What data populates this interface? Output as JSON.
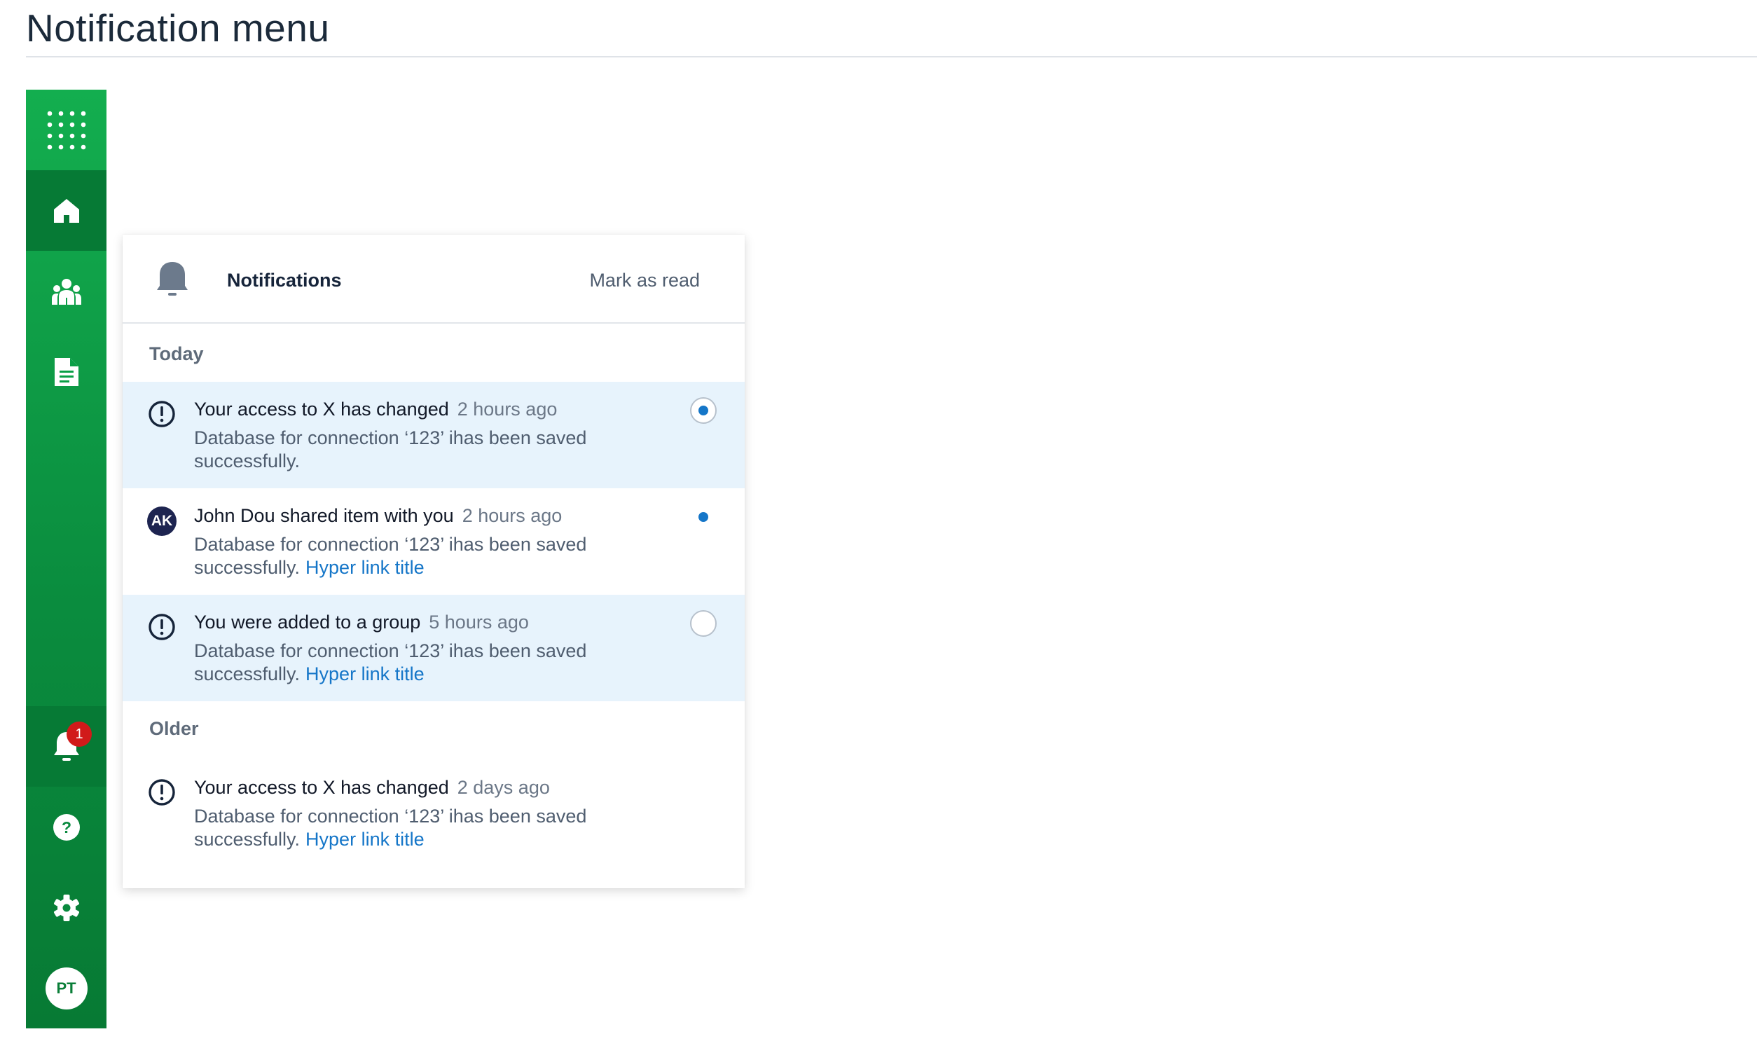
{
  "page": {
    "title": "Notification menu"
  },
  "sidebar": {
    "items": [
      {
        "name": "apps",
        "icon": "grid-icon"
      },
      {
        "name": "home",
        "icon": "home-icon",
        "active": true
      },
      {
        "name": "users",
        "icon": "users-icon"
      },
      {
        "name": "documents",
        "icon": "document-icon"
      },
      {
        "name": "notifications",
        "icon": "bell-icon",
        "active": true,
        "badge": "1"
      },
      {
        "name": "help",
        "icon": "help-icon"
      },
      {
        "name": "settings",
        "icon": "gear-icon"
      },
      {
        "name": "profile",
        "avatar_initials": "PT"
      }
    ],
    "colors": {
      "top": "#13ae4f",
      "bottom": "#077a34",
      "active": "#067a35",
      "badge": "#d11a1a"
    }
  },
  "panel": {
    "title": "Notifications",
    "mark_read": "Mark as read",
    "sections": [
      {
        "label": "Today",
        "items": [
          {
            "icon": "alert-icon",
            "title": "Your access to X has changed",
            "time": "2 hours ago",
            "body": "Database for connection ‘123’ ihas been saved successfully.",
            "link": "",
            "unread": true,
            "status": "ring-dot"
          },
          {
            "avatar": "AK",
            "title": "John Dou shared item with you",
            "time": "2 hours ago",
            "body": "Database for connection ‘123’ ihas been saved successfully.",
            "link": "Hyper link title",
            "unread": false,
            "status": "dot"
          },
          {
            "icon": "alert-icon",
            "title": "You were added to a group",
            "time": "5 hours ago",
            "body": "Database for connection ‘123’ ihas been saved successfully.",
            "link": "Hyper link title",
            "unread": true,
            "status": "ring"
          }
        ]
      },
      {
        "label": "Older",
        "items": [
          {
            "icon": "alert-icon",
            "title": "Your access to X has changed",
            "time": "2 days ago",
            "body": "Database for connection ‘123’ ihas been saved successfully.",
            "link": "Hyper link title",
            "unread": false,
            "status": "none"
          }
        ]
      }
    ],
    "colors": {
      "unread_bg": "#e7f3fc",
      "link": "#1576c8",
      "status_dot": "#1576c8"
    }
  }
}
